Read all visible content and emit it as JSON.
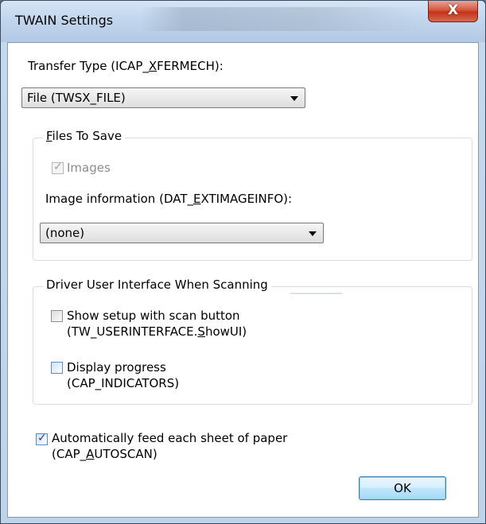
{
  "window": {
    "title": "TWAIN Settings",
    "close_glyph": "X"
  },
  "transfer": {
    "label_prefix": "Transfer Type (ICAP_",
    "label_mnemonic": "X",
    "label_suffix": "FERMECH):",
    "selected": "File (TWSX_FILE)"
  },
  "files_group": {
    "title_mnemonic": "F",
    "title_rest": "iles To Save",
    "images_label": "Images",
    "images_checked": true,
    "image_info_prefix": "Image information (DAT_",
    "image_info_mnemonic": "E",
    "image_info_suffix": "XTIMAGEINFO):",
    "image_info_selected": "(none)"
  },
  "driver_group": {
    "title": "Driver User Interface When Scanning",
    "show_setup_line1": "Show setup with scan button",
    "show_setup_line2_prefix": "(TW_USERINTERFACE.",
    "show_setup_line2_mnemonic": "S",
    "show_setup_line2_suffix": "howUI)",
    "show_setup_checked": false,
    "progress_line1": "Display progress",
    "progress_line2": "(CAP_INDICATORS)",
    "progress_checked": false
  },
  "autofeed": {
    "line1": "Automatically feed each sheet of paper",
    "line2_prefix": "(CAP_",
    "line2_mnemonic": "A",
    "line2_suffix": "UTOSCAN)",
    "checked": true
  },
  "buttons": {
    "ok_label": "OK"
  },
  "check_glyph": "✓"
}
